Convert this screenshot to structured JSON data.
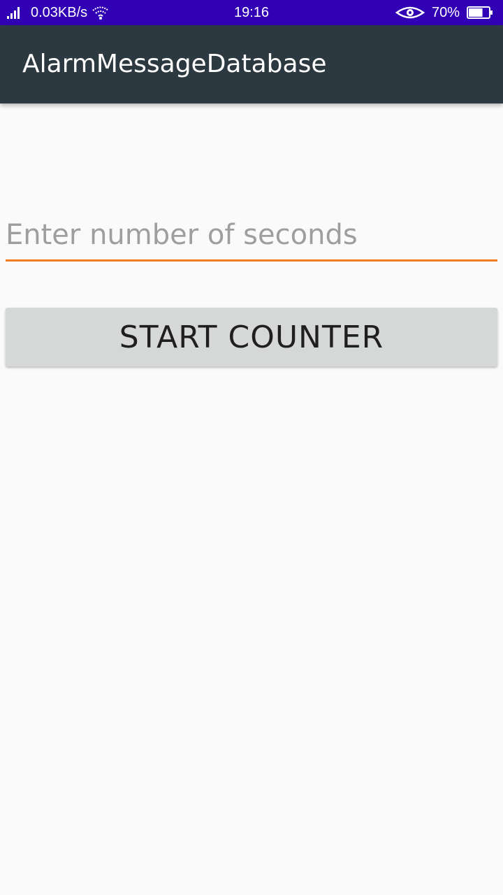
{
  "status_bar": {
    "network_speed": "0.03KB/s",
    "time": "19:16",
    "battery_percent": "70%",
    "background_color": "#3200b4",
    "icons": [
      "signal-icon",
      "wifi-icon",
      "eye-icon",
      "battery-icon"
    ],
    "battery_level": 0.7
  },
  "app_bar": {
    "title": "AlarmMessageDatabase",
    "background_color": "#2d3940"
  },
  "form": {
    "seconds_input": {
      "value": "",
      "placeholder": "Enter number of seconds",
      "underline_color": "#ef7d1f"
    },
    "start_button": {
      "label": "START COUNTER",
      "background_color": "#d6d7d7"
    }
  }
}
